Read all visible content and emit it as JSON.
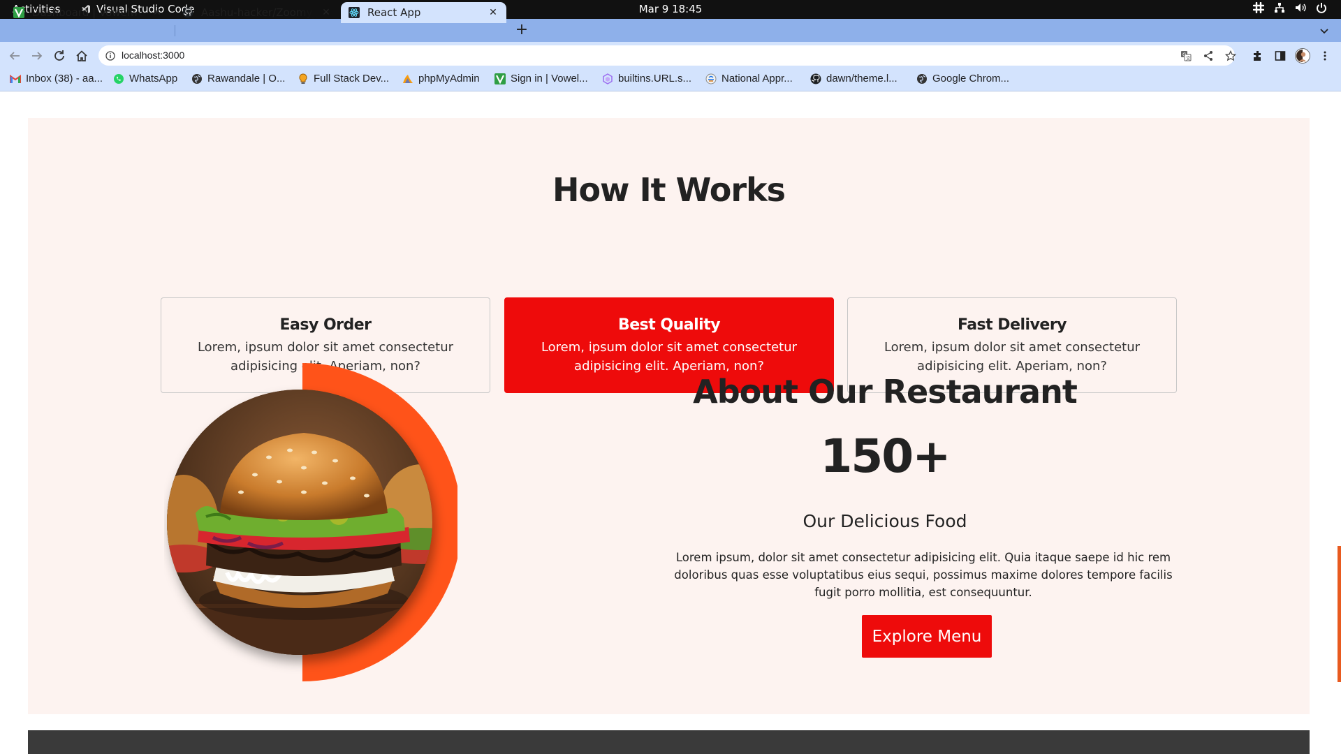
{
  "os": {
    "activities": "Activities",
    "app_name": "Visual Studio Code",
    "clock": "Mar 9  18:45",
    "tray_icons": [
      "slack-icon",
      "network-icon",
      "volume-icon",
      "power-icon"
    ]
  },
  "browser": {
    "tabs": [
      {
        "title": "Dashboard | Vowelweb Pr",
        "icon": "vowelweb-favicon",
        "active": false
      },
      {
        "title": "Aashu-hacker/Zoomy_foo",
        "icon": "github-favicon",
        "active": false
      },
      {
        "title": "React App",
        "icon": "react-favicon",
        "active": true
      }
    ],
    "url": "localhost:3000",
    "bookmarks": [
      {
        "label": "Inbox (38) - aa...",
        "icon": "gmail-icon"
      },
      {
        "label": "WhatsApp",
        "icon": "whatsapp-icon"
      },
      {
        "label": "Rawandale | O...",
        "icon": "globe-icon"
      },
      {
        "label": "Full Stack Dev...",
        "icon": "bulb-icon"
      },
      {
        "label": "phpMyAdmin",
        "icon": "phpmyadmin-icon"
      },
      {
        "label": "Sign in | Vowel...",
        "icon": "vowelweb-icon"
      },
      {
        "label": "builtins.URL.s...",
        "icon": "hex-icon"
      },
      {
        "label": "National Appr...",
        "icon": "emblem-icon"
      },
      {
        "label": "dawn/theme.l...",
        "icon": "github-icon"
      },
      {
        "label": "Google Chrom...",
        "icon": "globe-icon"
      }
    ]
  },
  "page": {
    "how_title": "How It Works",
    "cards": [
      {
        "title": "Easy Order",
        "desc": "Lorem, ipsum dolor sit amet consectetur adipisicing elit. Aperiam, non?"
      },
      {
        "title": "Best Quality",
        "desc": "Lorem, ipsum dolor sit amet consectetur adipisicing elit. Aperiam, non?"
      },
      {
        "title": "Fast Delivery",
        "desc": "Lorem, ipsum dolor sit amet consectetur adipisicing elit. Aperiam, non?"
      }
    ],
    "about": {
      "title": "About Our Restaurant",
      "stat": "150+",
      "stat_label": "Our Delicious Food",
      "text": "Lorem ipsum, dolor sit amet consectetur adipisicing elit. Quia itaque saepe id hic rem doloribus quas esse voluptatibus eius sequi, possimus maxime dolores tempore facilis fugit porro mollitia, est consequuntur.",
      "button": "Explore Menu"
    },
    "colors": {
      "accent": "#ee0b0b",
      "ring": "#ff5319",
      "section_bg": "#fdf3f0"
    }
  }
}
